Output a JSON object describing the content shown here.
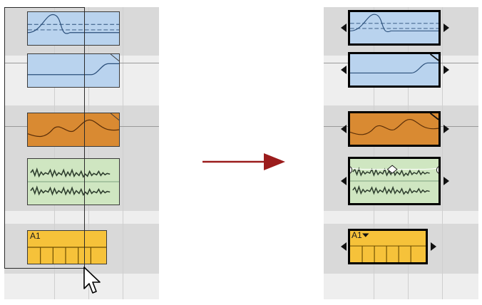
{
  "before": {
    "clips": [
      {
        "kind": "automation",
        "color": "#b9d3ee"
      },
      {
        "kind": "automation",
        "color": "#b9d3ee"
      },
      {
        "kind": "automation",
        "color": "#d98a32"
      },
      {
        "kind": "audio",
        "color": "#cfe6c1"
      },
      {
        "kind": "midi",
        "color": "#f6c23a",
        "label": "A1"
      }
    ],
    "selection": "marquee-drag"
  },
  "after": {
    "clips": [
      {
        "kind": "automation",
        "color": "#b9d3ee",
        "selected": true
      },
      {
        "kind": "automation",
        "color": "#b9d3ee",
        "selected": true
      },
      {
        "kind": "automation",
        "color": "#d98a32",
        "selected": true
      },
      {
        "kind": "audio",
        "color": "#cfe6c1",
        "selected": true
      },
      {
        "kind": "midi",
        "color": "#f6c23a",
        "label": "A1",
        "selected": true
      }
    ]
  },
  "transition_arrow_color": "#9b1c1c",
  "icons": [
    "mouse-pointer-icon",
    "resize-handle-left-icon",
    "resize-handle-right-icon",
    "dropdown-triangle-icon"
  ]
}
